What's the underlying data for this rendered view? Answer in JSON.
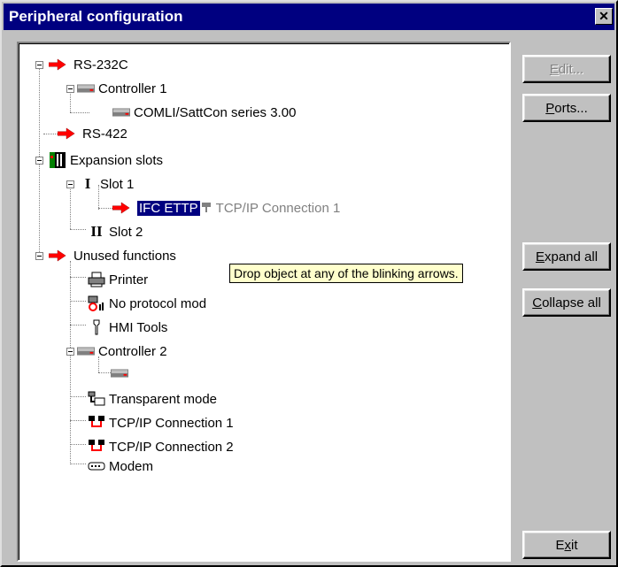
{
  "window": {
    "title": "Peripheral configuration",
    "close_glyph": "✕"
  },
  "tree": {
    "nodes": {
      "rs232c": "RS-232C",
      "controller1": "Controller 1",
      "comli": "COMLI/SattCon series 3.00",
      "rs422": "RS-422",
      "expansion_slots": "Expansion slots",
      "slot1": "Slot 1",
      "ifc_ettp": "IFC ETTP",
      "tcpip_drag": "TCP/IP Connection 1",
      "slot2": "Slot 2",
      "unused": "Unused functions",
      "printer": "Printer",
      "no_protocol": "No protocol mod",
      "hmi_tools": "HMI Tools",
      "controller2": "Controller 2",
      "transparent": "Transparent mode",
      "tcpip1": "TCP/IP Connection 1",
      "tcpip2": "TCP/IP Connection 2",
      "modem": "Modem"
    },
    "tooltip": "Drop object at any of the blinking arrows."
  },
  "buttons": {
    "edit": {
      "label": "Edit...",
      "mnemonic": "E"
    },
    "ports": {
      "label": "Ports...",
      "mnemonic": "P"
    },
    "expand_all": {
      "label": "Expand all",
      "mnemonic": "E"
    },
    "collapse_all": {
      "label": "Collapse all",
      "mnemonic": "C"
    },
    "exit": {
      "label": "Exit",
      "mnemonic": "x"
    }
  },
  "colors": {
    "arrow": "#ff0000",
    "selection": "#000080",
    "tooltip_bg": "#ffffcc"
  }
}
